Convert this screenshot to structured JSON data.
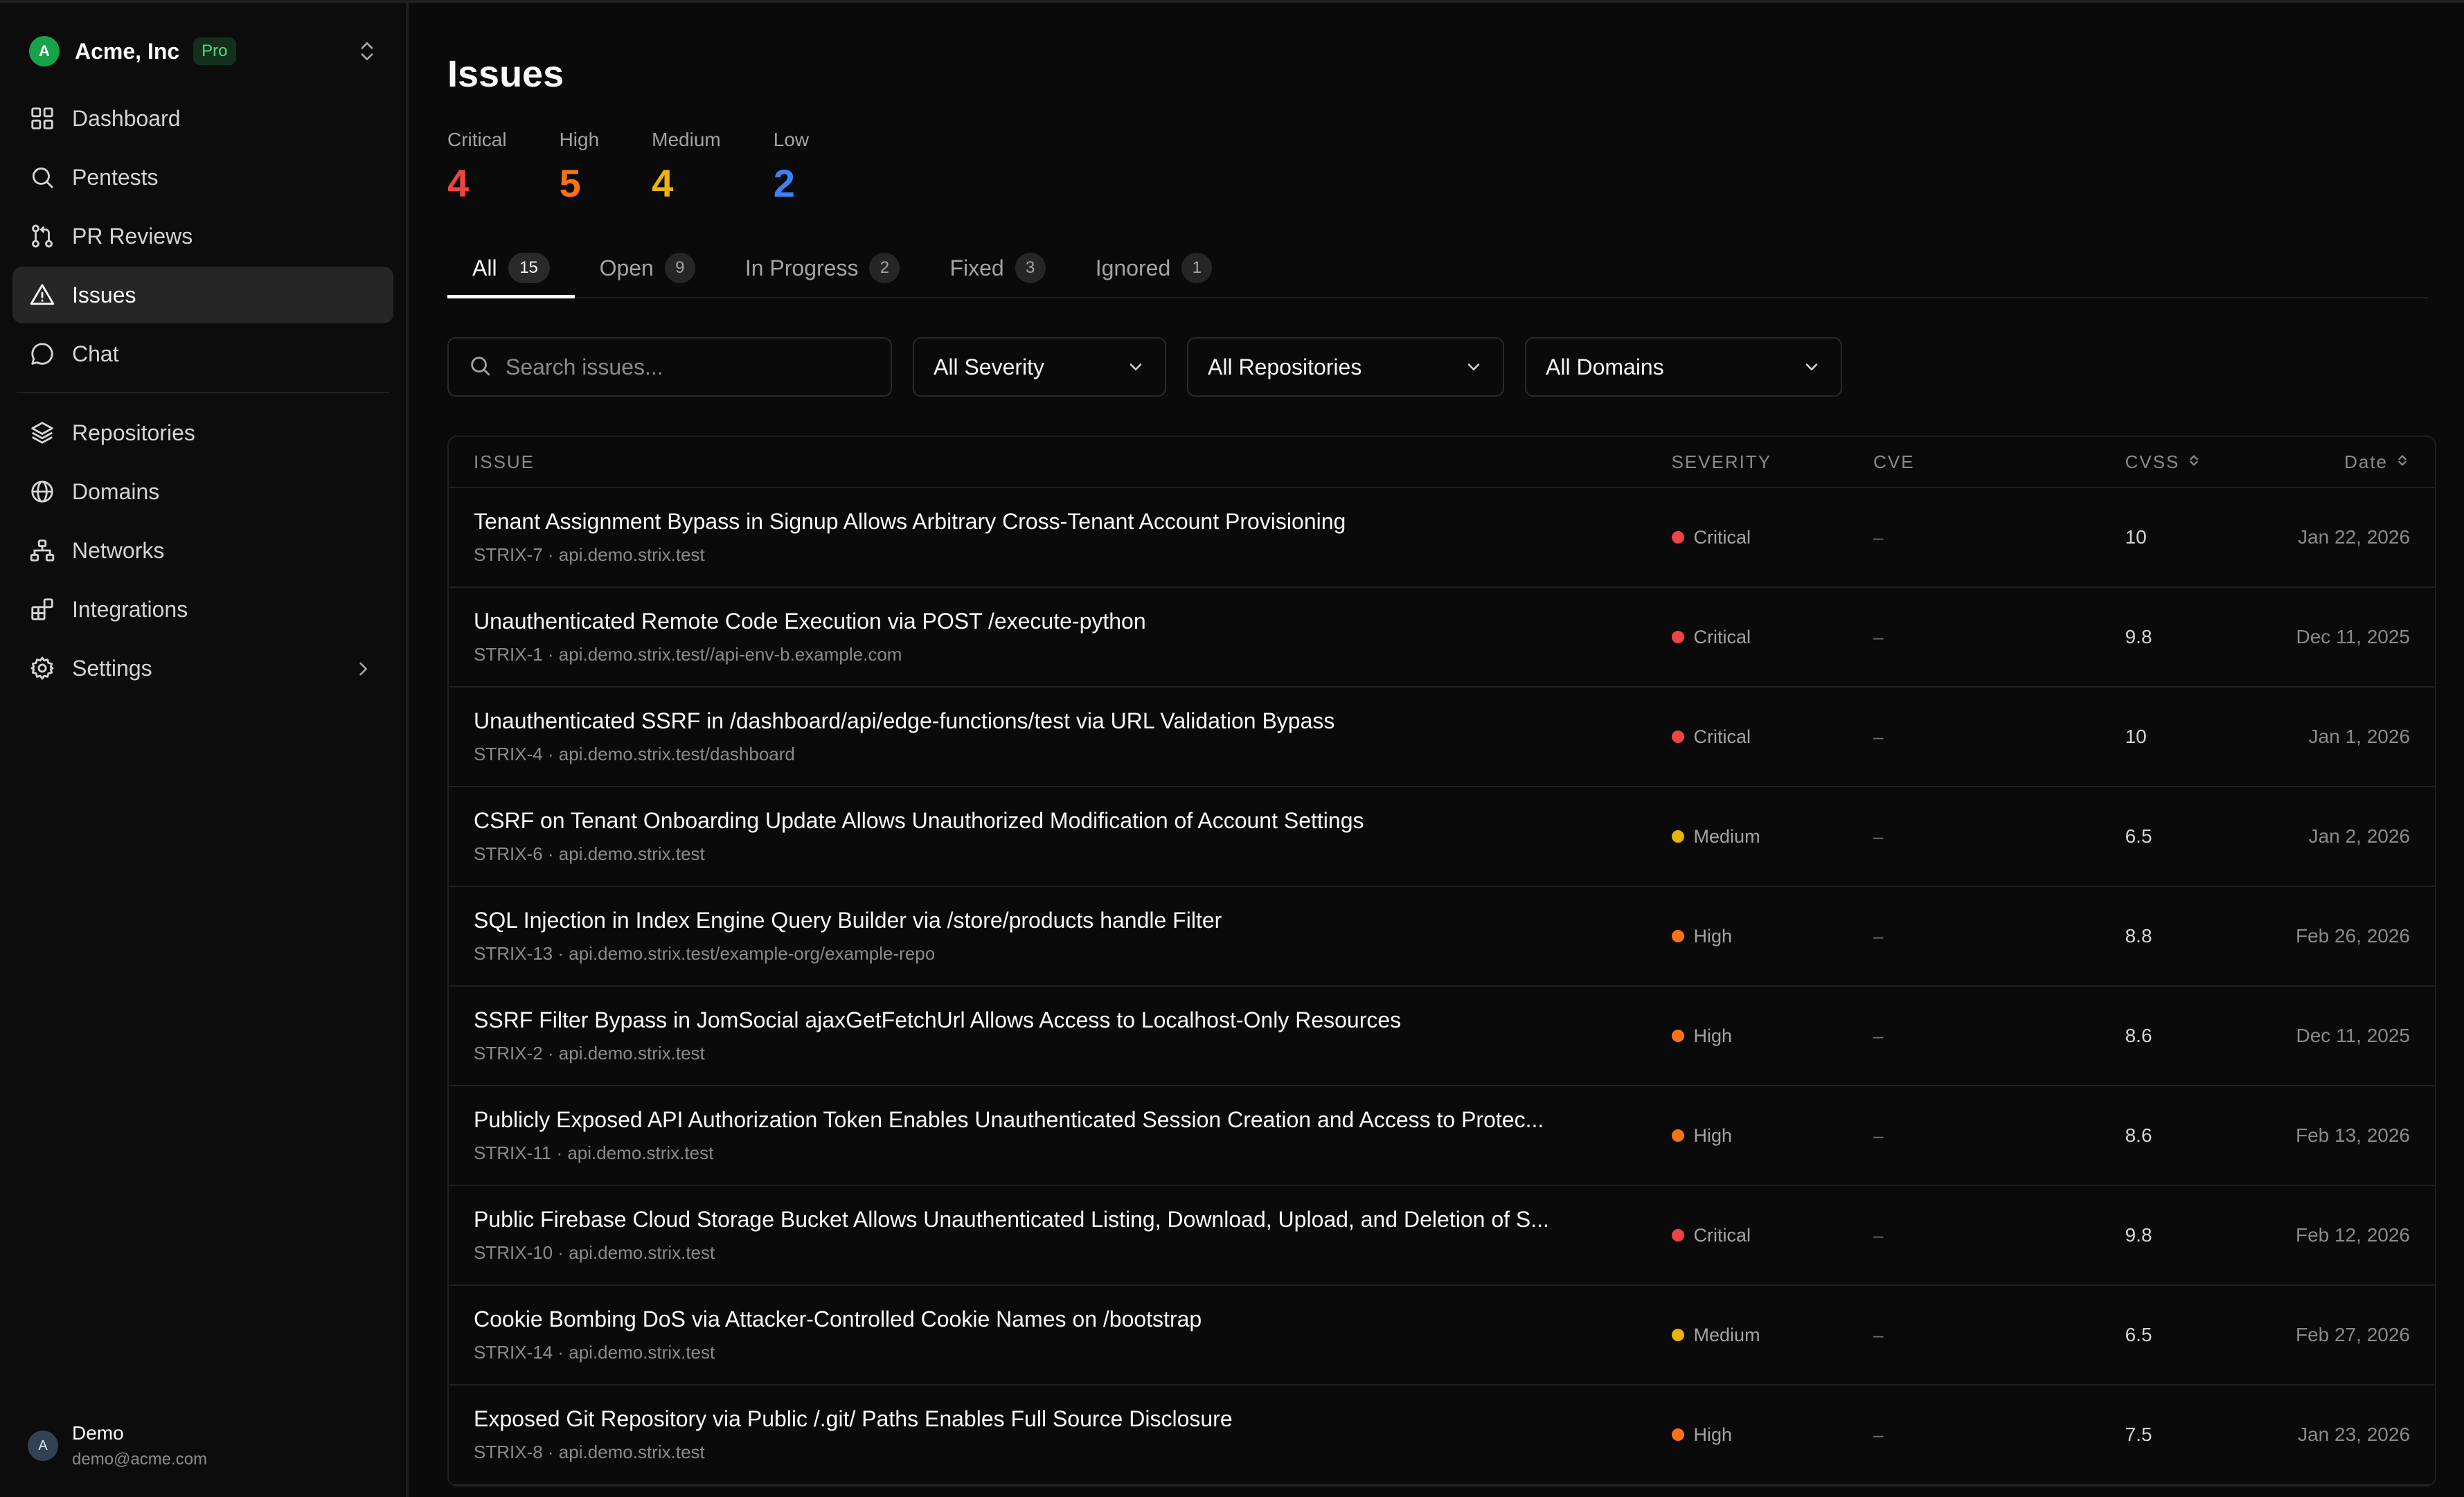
{
  "org": {
    "avatar_letter": "A",
    "name": "Acme, Inc",
    "plan_badge": "Pro"
  },
  "nav": [
    {
      "label": "Dashboard",
      "icon": "grid-icon"
    },
    {
      "label": "Pentests",
      "icon": "search-icon"
    },
    {
      "label": "PR Reviews",
      "icon": "git-pull-request-icon"
    },
    {
      "label": "Issues",
      "icon": "warning-triangle-icon",
      "active": true
    },
    {
      "label": "Chat",
      "icon": "chat-bubble-icon"
    },
    {
      "label": "Repositories",
      "icon": "layers-icon"
    },
    {
      "label": "Domains",
      "icon": "globe-icon"
    },
    {
      "label": "Networks",
      "icon": "network-icon"
    },
    {
      "label": "Integrations",
      "icon": "blocks-icon"
    },
    {
      "label": "Settings",
      "icon": "gear-icon",
      "has_chevron": true
    }
  ],
  "user": {
    "avatar_letter": "A",
    "name": "Demo",
    "email": "demo@acme.com"
  },
  "page": {
    "title": "Issues"
  },
  "stats": [
    {
      "label": "Critical",
      "value": "4",
      "color": "#ef4444"
    },
    {
      "label": "High",
      "value": "5",
      "color": "#f97316"
    },
    {
      "label": "Medium",
      "value": "4",
      "color": "#eab308"
    },
    {
      "label": "Low",
      "value": "2",
      "color": "#3b82f6"
    }
  ],
  "tabs": [
    {
      "label": "All",
      "count": "15",
      "active": true
    },
    {
      "label": "Open",
      "count": "9"
    },
    {
      "label": "In Progress",
      "count": "2"
    },
    {
      "label": "Fixed",
      "count": "3"
    },
    {
      "label": "Ignored",
      "count": "1"
    }
  ],
  "filters": {
    "search_placeholder": "Search issues...",
    "search_value": "",
    "severity": "All Severity",
    "repositories": "All Repositories",
    "domains": "All Domains"
  },
  "table": {
    "headers": {
      "issue": "ISSUE",
      "severity": "SEVERITY",
      "cve": "CVE",
      "cvss": "CVSS",
      "date": "Date"
    },
    "severity_colors": {
      "Critical": "#ef4444",
      "High": "#f97316",
      "Medium": "#eab308",
      "Low": "#3b82f6"
    },
    "rows": [
      {
        "title": "Tenant Assignment Bypass in Signup Allows Arbitrary Cross-Tenant Account Provisioning",
        "meta": "STRIX-7 · api.demo.strix.test",
        "severity": "Critical",
        "cve": "–",
        "cvss": "10",
        "date": "Jan 22, 2026"
      },
      {
        "title": "Unauthenticated Remote Code Execution via POST /execute-python",
        "meta": "STRIX-1 · api.demo.strix.test//api-env-b.example.com",
        "severity": "Critical",
        "cve": "–",
        "cvss": "9.8",
        "date": "Dec 11, 2025"
      },
      {
        "title": "Unauthenticated SSRF in /dashboard/api/edge-functions/test via URL Validation Bypass",
        "meta": "STRIX-4 · api.demo.strix.test/dashboard",
        "severity": "Critical",
        "cve": "–",
        "cvss": "10",
        "date": "Jan 1, 2026"
      },
      {
        "title": "CSRF on Tenant Onboarding Update Allows Unauthorized Modification of Account Settings",
        "meta": "STRIX-6 · api.demo.strix.test",
        "severity": "Medium",
        "cve": "–",
        "cvss": "6.5",
        "date": "Jan 2, 2026"
      },
      {
        "title": "SQL Injection in Index Engine Query Builder via /store/products handle Filter",
        "meta": "STRIX-13 · api.demo.strix.test/example-org/example-repo",
        "severity": "High",
        "cve": "–",
        "cvss": "8.8",
        "date": "Feb 26, 2026"
      },
      {
        "title": "SSRF Filter Bypass in JomSocial ajaxGetFetchUrl Allows Access to Localhost-Only Resources",
        "meta": "STRIX-2 · api.demo.strix.test",
        "severity": "High",
        "cve": "–",
        "cvss": "8.6",
        "date": "Dec 11, 2025"
      },
      {
        "title": "Publicly Exposed API Authorization Token Enables Unauthenticated Session Creation and Access to Protec...",
        "meta": "STRIX-11 · api.demo.strix.test",
        "severity": "High",
        "cve": "–",
        "cvss": "8.6",
        "date": "Feb 13, 2026"
      },
      {
        "title": "Public Firebase Cloud Storage Bucket Allows Unauthenticated Listing, Download, Upload, and Deletion of S...",
        "meta": "STRIX-10 · api.demo.strix.test",
        "severity": "Critical",
        "cve": "–",
        "cvss": "9.8",
        "date": "Feb 12, 2026"
      },
      {
        "title": "Cookie Bombing DoS via Attacker-Controlled Cookie Names on /bootstrap",
        "meta": "STRIX-14 · api.demo.strix.test",
        "severity": "Medium",
        "cve": "–",
        "cvss": "6.5",
        "date": "Feb 27, 2026"
      },
      {
        "title": "Exposed Git Repository via Public /.git/ Paths Enables Full Source Disclosure",
        "meta": "STRIX-8 · api.demo.strix.test",
        "severity": "High",
        "cve": "–",
        "cvss": "7.5",
        "date": "Jan 23, 2026"
      }
    ]
  }
}
